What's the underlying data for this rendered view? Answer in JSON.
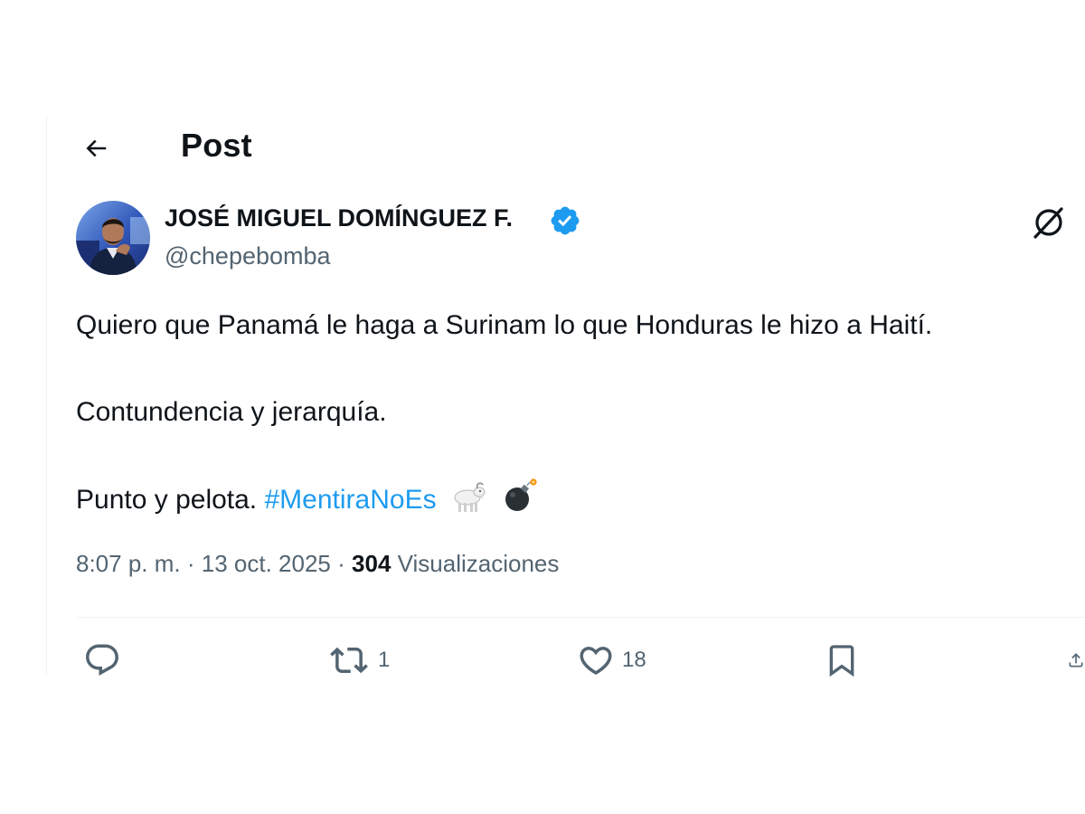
{
  "header": {
    "title": "Post"
  },
  "author": {
    "name": "JOSÉ MIGUEL DOMÍNGUEZ F.",
    "handle": "@chepebomba",
    "verified": true
  },
  "tweet": {
    "line1": "Quiero que Panamá le haga a Surinam lo que Honduras le hizo a Haití.",
    "line2": "Contundencia y jerarquía.",
    "line3_text": "Punto y pelota.",
    "hashtag": "#MentiraNoEs",
    "emojis": [
      "goat-icon",
      "bomb-icon"
    ]
  },
  "meta": {
    "time": "8:07 p. m.",
    "separator": "·",
    "date": "13 oct. 2025",
    "views_count": "304",
    "views_label": "Visualizaciones"
  },
  "actions": {
    "reply_count": "",
    "repost_count": "1",
    "like_count": "18"
  },
  "colors": {
    "accent": "#1d9bf0",
    "text_primary": "#0f1419",
    "text_secondary": "#536471",
    "divider": "#eff3f4"
  }
}
